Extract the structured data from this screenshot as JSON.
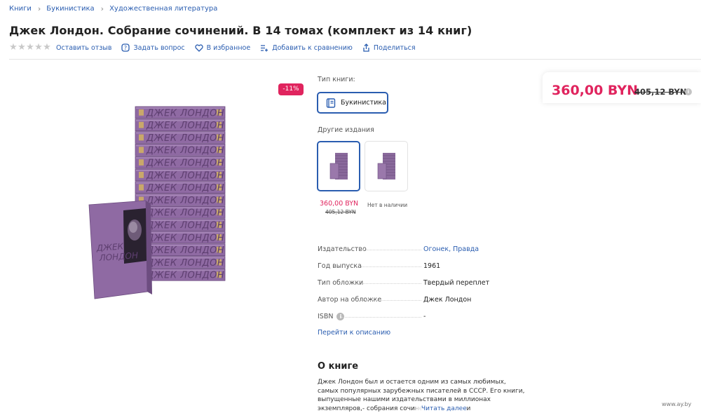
{
  "breadcrumb": {
    "items": [
      "Книги",
      "Букинистика",
      "Художественная литература"
    ]
  },
  "product": {
    "title": "Джек Лондон. Собрание сочинений. В 14 томах (комплект из 14 книг)",
    "discount_badge": "-11%",
    "rating_stars": 0,
    "rating_max": 5
  },
  "actions": {
    "review": "Оставить отзыв",
    "question": "Задать вопрос",
    "favorite": "В избранное",
    "compare": "Добавить к сравнению",
    "share": "Поделиться"
  },
  "book_type": {
    "label": "Тип книги:",
    "selected": "Букинистика"
  },
  "other_editions": {
    "label": "Другие издания",
    "items": [
      {
        "price": "360,00 BYN",
        "old_price": "405,12 BYN",
        "selected": true
      },
      {
        "status": "Нет в наличии",
        "selected": false
      }
    ]
  },
  "specs": [
    {
      "key": "Издательство",
      "value_links": [
        "Огонек",
        "Правда"
      ]
    },
    {
      "key": "Год выпуска",
      "value": "1961"
    },
    {
      "key": "Тип обложки",
      "value": "Твердый переплет"
    },
    {
      "key": "Автор на обложке",
      "value": "Джек Лондон"
    },
    {
      "key": "ISBN",
      "value": "-"
    }
  ],
  "go_to_description": "Перейти к описанию",
  "about": {
    "title": "О книге",
    "text": "Джек Лондон был и остается одним из самых любимых, самых популярных зарубежных писателей в СССР. Его книги, выпущенные нашими издательствами в миллионах экземпляров,- собрания сочинений, сборники",
    "read_more": "Читать далее"
  },
  "price": {
    "current": "360,00 BYN",
    "old": "405,12 BYN"
  },
  "cover": {
    "spine_text": "ДЖЕК ЛОНДОН",
    "front_text": "ДЖЕК ЛОНДОН",
    "volumes": 14
  },
  "watermark": "www.ay.by",
  "colors": {
    "accent": "#2a5db0",
    "price": "#e0245e",
    "book_purple": "#8f6aa3"
  }
}
